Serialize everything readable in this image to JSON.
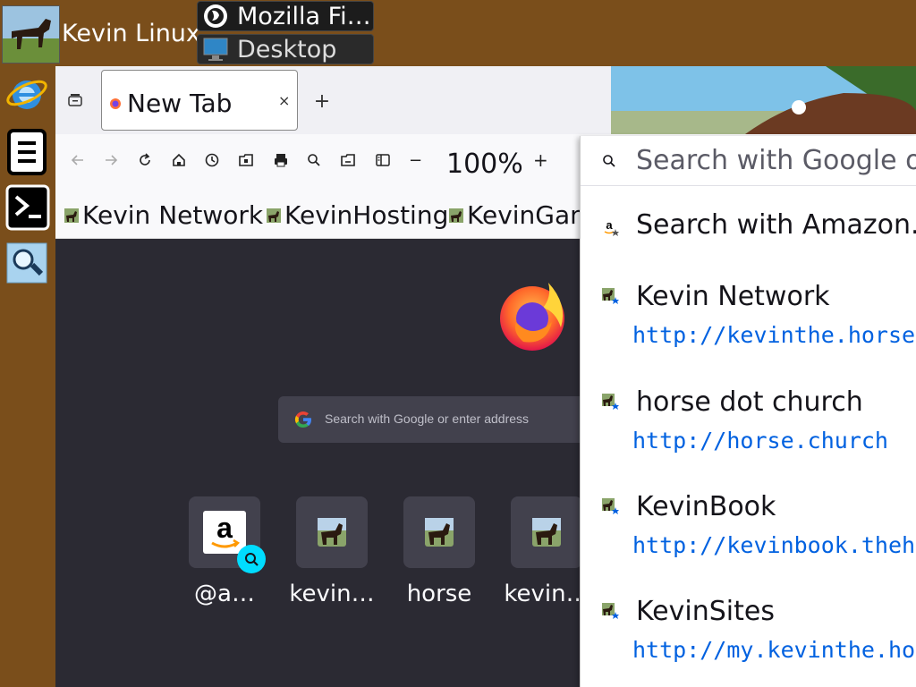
{
  "top_panel": {
    "user_name": "Kevin Linux",
    "tasks": [
      {
        "label": "Mozilla Fi…",
        "icon": "firefox-icon"
      },
      {
        "label": "Desktop",
        "icon": "desktop-icon"
      }
    ]
  },
  "dock": {
    "items": [
      {
        "icon": "internet-explorer-icon"
      },
      {
        "icon": "file-cabinet-icon"
      },
      {
        "icon": "terminal-icon"
      },
      {
        "icon": "magnifier-icon"
      }
    ]
  },
  "browser": {
    "tab": {
      "title": "New Tab",
      "close": "×"
    },
    "new_tab": "+",
    "toolbar": {
      "zoom": "100%",
      "zoom_minus": "−",
      "zoom_plus": "+"
    },
    "bookmarks": [
      {
        "label": "Kevin Network"
      },
      {
        "label": "KevinHosting"
      },
      {
        "label": "KevinGam"
      }
    ],
    "newtab": {
      "search_placeholder": "Search with Google or enter address",
      "tiles": [
        {
          "label": "@a…",
          "icon": "amazon-icon"
        },
        {
          "label": "kevin…",
          "icon": "horse-icon"
        },
        {
          "label": "horse",
          "icon": "horse-icon"
        },
        {
          "label": "kevin…",
          "icon": "horse-icon"
        }
      ]
    }
  },
  "urlbar": {
    "placeholder": "Search with Google or",
    "results": [
      {
        "title": "Search with Amazon.co",
        "url": ""
      },
      {
        "title": "Kevin Network",
        "url": "http://kevinthe.horse"
      },
      {
        "title": "horse dot church",
        "url": "http://horse.church"
      },
      {
        "title": "KevinBook",
        "url": "http://kevinbook.thehorsep"
      },
      {
        "title": "KevinSites",
        "url": "http://my.kevinthe.horse"
      }
    ]
  },
  "colors": {
    "panel_brown": "#7a4e1b",
    "ff_dark": "#2b2a33",
    "link_blue": "#0061e0"
  }
}
